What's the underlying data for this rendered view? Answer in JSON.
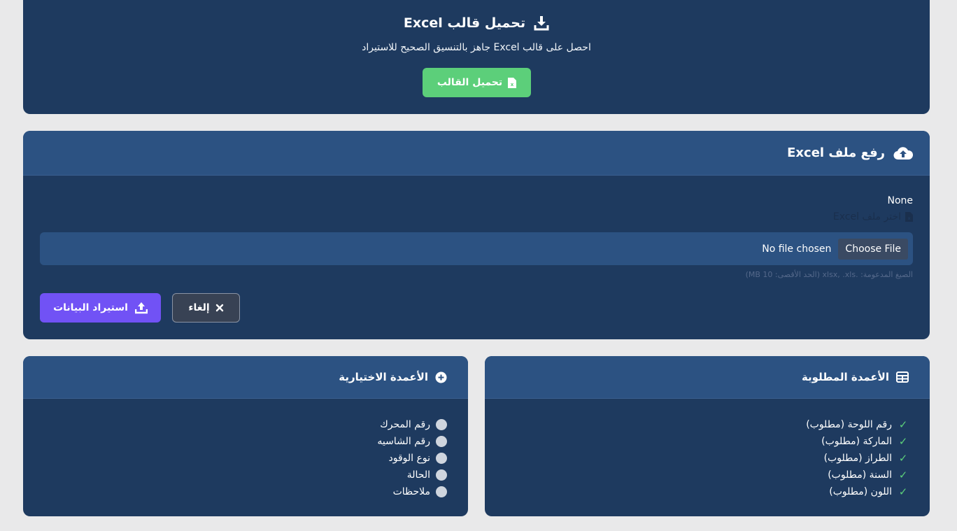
{
  "template_card": {
    "title": "تحميل قالب Excel",
    "description": "احصل على قالب Excel جاهز بالتنسيق الصحيح للاستيراد",
    "download_button": "تحميل القالب"
  },
  "upload_card": {
    "title": "رفع ملف Excel",
    "none_text": "None",
    "file_label": "اختر ملف Excel",
    "choose_file_button": "Choose File",
    "no_file_text": "No file chosen",
    "hint": "الصيغ المدعومة: .xlsx, .xls (الحد الأقصى: 10 MB)",
    "cancel_button": "إلغاء",
    "import_button": "استيراد البيانات"
  },
  "required_columns": {
    "title": "الأعمدة المطلوبة",
    "items": [
      "رقم اللوحة (مطلوب)",
      "الماركة (مطلوب)",
      "الطراز (مطلوب)",
      "السنة (مطلوب)",
      "اللون (مطلوب)"
    ]
  },
  "optional_columns": {
    "title": "الأعمدة الاختيارية",
    "items": [
      "رقم المحرك",
      "رقم الشاسيه",
      "نوع الوقود",
      "الحالة",
      "ملاحظات"
    ]
  },
  "colors": {
    "card_bg": "#1e3a5f",
    "header_bg": "#2c5282",
    "success_green": "#5ccf7a",
    "primary_purple": "#7152f5"
  },
  "icons": {
    "template_title": "download-icon",
    "download_button": "excel-file-icon",
    "upload_title": "cloud-upload-icon",
    "file_label": "excel-file-icon",
    "cancel_button": "close-icon",
    "import_button": "upload-icon",
    "required_title": "table-icon",
    "optional_title": "plus-circle-icon",
    "required_item": "check-icon",
    "optional_item": "circle-dot-icon"
  }
}
